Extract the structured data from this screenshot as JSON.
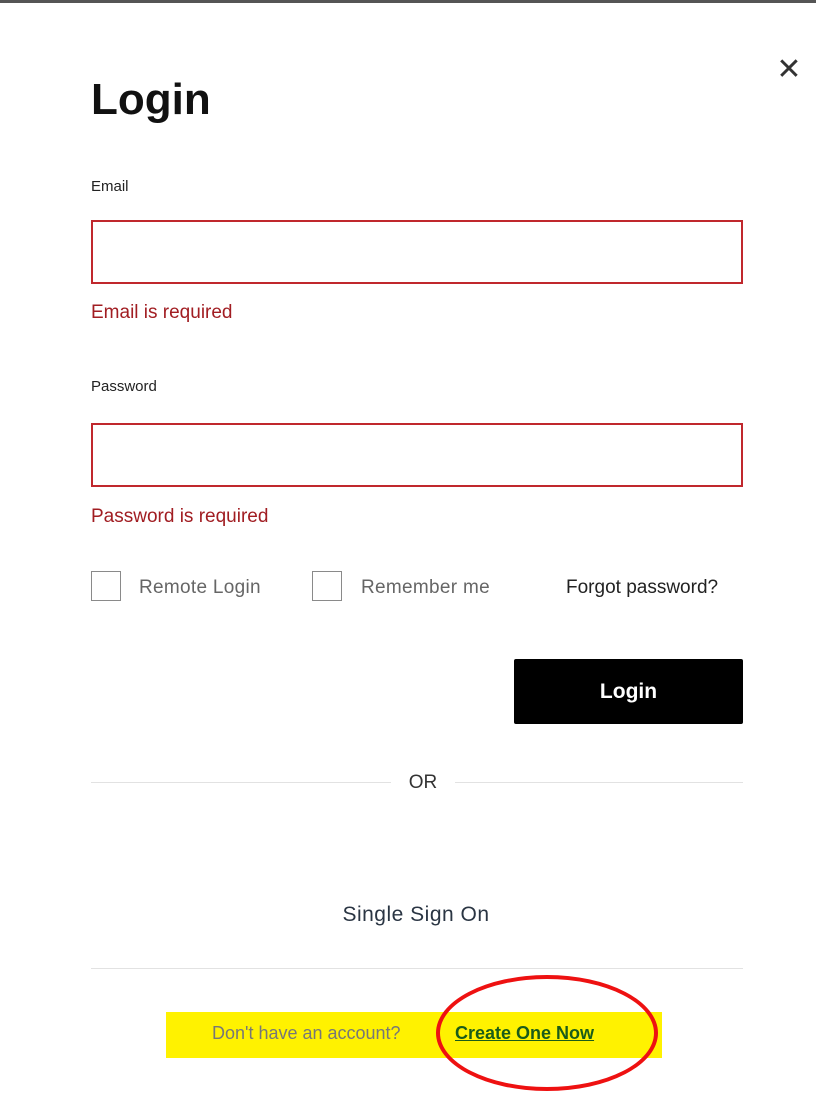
{
  "dialog": {
    "title": "Login",
    "close_icon": "close-icon"
  },
  "email": {
    "label": "Email",
    "value": "",
    "error": "Email is required"
  },
  "password": {
    "label": "Password",
    "value": "",
    "error": "Password is required"
  },
  "options": {
    "remote_login_label": "Remote Login",
    "remote_login_checked": false,
    "remember_me_label": "Remember me",
    "remember_me_checked": false,
    "forgot_password_label": "Forgot password?"
  },
  "actions": {
    "login_label": "Login",
    "or_label": "OR",
    "sso_label": "Single Sign On"
  },
  "signup": {
    "prompt": "Don't have an account?",
    "link_label": "Create One Now"
  },
  "colors": {
    "error": "#a11d22",
    "input_border_error": "#c0282d",
    "button_bg": "#000000",
    "highlight": "#fff200",
    "annotation": "#ee1111"
  }
}
